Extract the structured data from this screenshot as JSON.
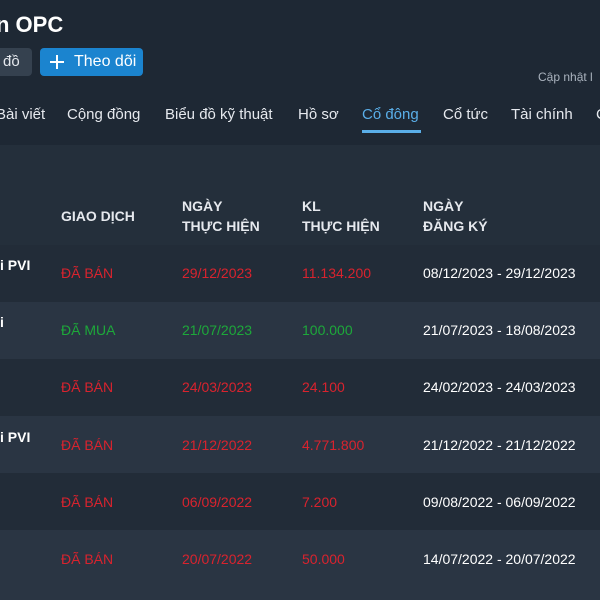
{
  "header": {
    "title": "n OPC",
    "chart_button": "đồ",
    "follow_button": "Theo dõi",
    "updated": "Cập nhật l"
  },
  "tabs": [
    "Bài viết",
    "Cộng đồng",
    "Biểu đồ kỹ thuật",
    "Hồ sơ",
    "Cổ đông",
    "Cổ tức",
    "Tài chính",
    "C"
  ],
  "active_tab": "Cổ đông",
  "table": {
    "headers": {
      "transaction": "GIAO DỊCH",
      "exec_date_1": "NGÀY",
      "exec_date_2": "THỰC HIỆN",
      "volume_1": "KL",
      "volume_2": "THỰC HIỆN",
      "reg_date_1": "NGÀY",
      "reg_date_2": "ĐĂNG KÝ"
    },
    "rows": [
      {
        "name": "i PVI",
        "type": "ĐÃ BÁN",
        "date": "29/12/2023",
        "volume": "11.134.200",
        "registered": "08/12/2023 - 29/12/2023"
      },
      {
        "name": "i",
        "type": "ĐÃ MUA",
        "date": "21/07/2023",
        "volume": "100.000",
        "registered": "21/07/2023 - 18/08/2023"
      },
      {
        "name": "",
        "type": "ĐÃ BÁN",
        "date": "24/03/2023",
        "volume": "24.100",
        "registered": "24/02/2023 - 24/03/2023"
      },
      {
        "name": "i PVI",
        "type": "ĐÃ BÁN",
        "date": "21/12/2022",
        "volume": "4.771.800",
        "registered": "21/12/2022 - 21/12/2022"
      },
      {
        "name": "",
        "type": "ĐÃ BÁN",
        "date": "06/09/2022",
        "volume": "7.200",
        "registered": "09/08/2022 - 06/09/2022"
      },
      {
        "name": "",
        "type": "ĐÃ BÁN",
        "date": "20/07/2022",
        "volume": "50.000",
        "registered": "14/07/2022 - 20/07/2022"
      }
    ]
  },
  "colors": {
    "sell": "#d9232e",
    "buy": "#1da83a",
    "accent": "#5aaee8",
    "follow_button": "#1b84cf"
  }
}
